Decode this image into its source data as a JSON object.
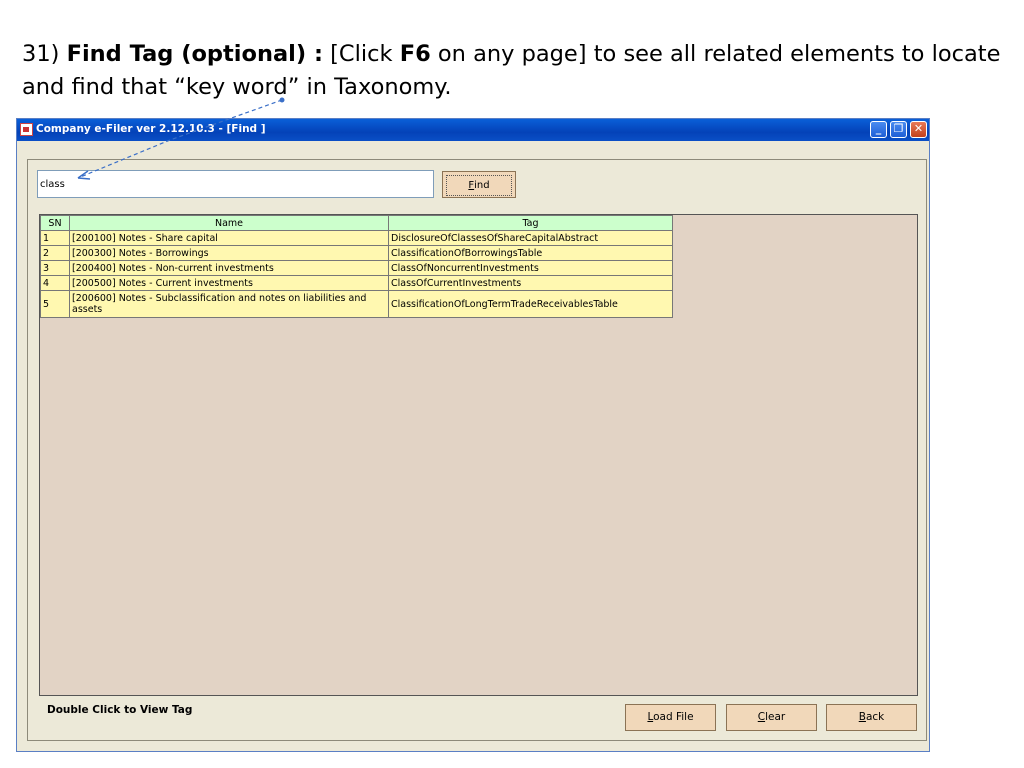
{
  "instruction": {
    "step": "31)",
    "bold_title": "Find Tag (optional) :",
    "text_1": " [Click ",
    "bold_key": "F6",
    "text_2": " on any page]  to see all related elements to locate and find that “key word” in Taxonomy."
  },
  "window": {
    "title": "Company e-Filer ver 2.12.10.3 - [Find ]",
    "controls": {
      "minimize": "_",
      "restore": "❐",
      "close": "✕"
    }
  },
  "search": {
    "value": "class",
    "find_label_first": "F",
    "find_label_rest": "ind"
  },
  "table": {
    "headers": [
      "SN",
      "Name",
      "Tag"
    ],
    "rows": [
      {
        "sn": "1",
        "name": "[200100] Notes - Share capital",
        "tag": "DisclosureOfClassesOfShareCapitalAbstract"
      },
      {
        "sn": "2",
        "name": "[200300] Notes - Borrowings",
        "tag": "ClassificationOfBorrowingsTable"
      },
      {
        "sn": "3",
        "name": "[200400] Notes - Non-current investments",
        "tag": "ClassOfNoncurrentInvestments"
      },
      {
        "sn": "4",
        "name": "[200500] Notes - Current investments",
        "tag": "ClassOfCurrentInvestments"
      },
      {
        "sn": "5",
        "name": "[200600] Notes - Subclassification and notes on liabilities and assets",
        "tag": "ClassificationOfLongTermTradeReceivablesTable"
      }
    ]
  },
  "status": {
    "hint": "Double Click to View Tag"
  },
  "buttons": {
    "load_file": {
      "first": "L",
      "rest": "oad File"
    },
    "clear": {
      "first": "C",
      "rest": "lear"
    },
    "back": {
      "first": "B",
      "rest": "ack"
    }
  },
  "colors": {
    "title_bar": "#0442b8",
    "window_bg": "#ece9d8",
    "grid_bg": "#e2d3c5",
    "header_bg": "#ccffcc",
    "row_bg": "#fff8b0",
    "button_bg": "#f1d8ba",
    "arrow": "#3a6fc8"
  }
}
